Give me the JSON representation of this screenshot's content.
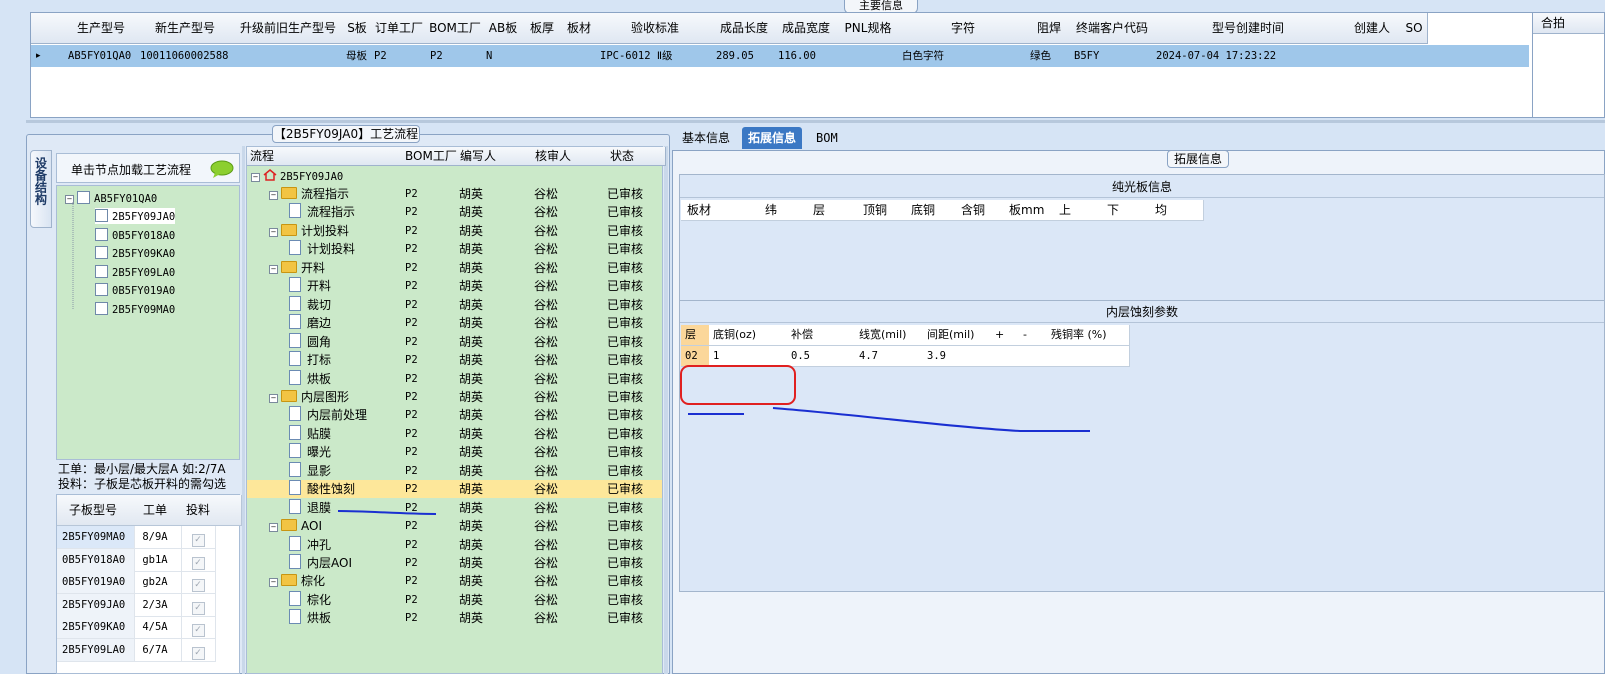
{
  "main_info": {
    "tab_label": "主要信息",
    "columns": [
      "生产型号",
      "新生产型号",
      "升级前旧生产型号",
      "S板",
      "订单工厂",
      "BOM工厂",
      "AB板",
      "板厚",
      "板材",
      "验收标准",
      "成品长度",
      "成品宽度",
      "PNL规格",
      "字符",
      "阻焊",
      "终端客户代码",
      "型号创建时间",
      "创建人",
      "SO"
    ],
    "row": {
      "marker": "▸",
      "生产型号": "AB5FY01QA0",
      "新生产型号": "10011060002588",
      "升级前旧生产型号": "",
      "S板": "母板",
      "订单工厂": "P2",
      "BOM工厂": "P2",
      "AB板": "N",
      "板厚": "",
      "板材": "",
      "验收标准": "IPC-6012 Ⅱ级",
      "成品长度": "289.05",
      "成品宽度": "116.00",
      "PNL规格": "",
      "字符": "白色字符",
      "阻焊": "绿色",
      "终端客户代码": "B5FY",
      "型号创建时间": "2024-07-04 17:23:22",
      "创建人": "",
      "SO": ""
    },
    "right_mini_header": "合",
    "right_mini_header_tail": "拍"
  },
  "process": {
    "title": "【2B5FY09JA0】工艺流程",
    "vertical_tab": "设备结构",
    "load_hint": "单击节点加载工艺流程",
    "tree": {
      "root": "AB5FY01QA0",
      "children": [
        "2B5FY09JA0",
        "0B5FY018A0",
        "2B5FY09KA0",
        "2B5FY09LA0",
        "0B5FY019A0",
        "2B5FY09MA0"
      ]
    },
    "note_line1": "工单：最小层/最大层A 如:2/7A",
    "note_line2": "投料：子板是芯板开料的需勾选",
    "sub_columns": [
      "子板型号",
      "工单",
      "投料"
    ],
    "sub_rows": [
      {
        "model": "2B5FY09MA0",
        "order": "8/9A",
        "checked": "✓"
      },
      {
        "model": "0B5FY018A0",
        "order": "gb1A",
        "checked": "✓"
      },
      {
        "model": "0B5FY019A0",
        "order": "gb2A",
        "checked": "✓"
      },
      {
        "model": "2B5FY09JA0",
        "order": "2/3A",
        "checked": "✓"
      },
      {
        "model": "2B5FY09KA0",
        "order": "4/5A",
        "checked": "✓"
      },
      {
        "model": "2B5FY09LA0",
        "order": "6/7A",
        "checked": "✓"
      }
    ],
    "flow_columns": [
      "流程",
      "BOM工厂",
      "编写人",
      "核审人",
      "状态"
    ],
    "flow_root": "2B5FY09JA0",
    "flow_rows": [
      {
        "name": "流程指示",
        "type": "folder",
        "bom": "P2",
        "writer": "胡英",
        "reviewer": "谷松",
        "status": "已审核"
      },
      {
        "name": "流程指示",
        "type": "doc",
        "bom": "P2",
        "writer": "胡英",
        "reviewer": "谷松",
        "status": "已审核"
      },
      {
        "name": "计划投料",
        "type": "folder",
        "bom": "P2",
        "writer": "胡英",
        "reviewer": "谷松",
        "status": "已审核"
      },
      {
        "name": "计划投料",
        "type": "doc",
        "bom": "P2",
        "writer": "胡英",
        "reviewer": "谷松",
        "status": "已审核"
      },
      {
        "name": "开料",
        "type": "folder",
        "bom": "P2",
        "writer": "胡英",
        "reviewer": "谷松",
        "status": "已审核"
      },
      {
        "name": "开料",
        "type": "doc",
        "bom": "P2",
        "writer": "胡英",
        "reviewer": "谷松",
        "status": "已审核"
      },
      {
        "name": "裁切",
        "type": "doc",
        "bom": "P2",
        "writer": "胡英",
        "reviewer": "谷松",
        "status": "已审核"
      },
      {
        "name": "磨边",
        "type": "doc",
        "bom": "P2",
        "writer": "胡英",
        "reviewer": "谷松",
        "status": "已审核"
      },
      {
        "name": "圆角",
        "type": "doc",
        "bom": "P2",
        "writer": "胡英",
        "reviewer": "谷松",
        "status": "已审核"
      },
      {
        "name": "打标",
        "type": "doc",
        "bom": "P2",
        "writer": "胡英",
        "reviewer": "谷松",
        "status": "已审核"
      },
      {
        "name": "烘板",
        "type": "doc",
        "bom": "P2",
        "writer": "胡英",
        "reviewer": "谷松",
        "status": "已审核"
      },
      {
        "name": "内层图形",
        "type": "folder",
        "bom": "P2",
        "writer": "胡英",
        "reviewer": "谷松",
        "status": "已审核"
      },
      {
        "name": "内层前处理",
        "type": "doc",
        "bom": "P2",
        "writer": "胡英",
        "reviewer": "谷松",
        "status": "已审核"
      },
      {
        "name": "贴膜",
        "type": "doc",
        "bom": "P2",
        "writer": "胡英",
        "reviewer": "谷松",
        "status": "已审核"
      },
      {
        "name": "曝光",
        "type": "doc",
        "bom": "P2",
        "writer": "胡英",
        "reviewer": "谷松",
        "status": "已审核"
      },
      {
        "name": "显影",
        "type": "doc",
        "bom": "P2",
        "writer": "胡英",
        "reviewer": "谷松",
        "status": "已审核"
      },
      {
        "name": "酸性蚀刻",
        "type": "doc",
        "bom": "P2",
        "writer": "胡英",
        "reviewer": "谷松",
        "status": "已审核",
        "selected": true
      },
      {
        "name": "退膜",
        "type": "doc",
        "bom": "P2",
        "writer": "胡英",
        "reviewer": "谷松",
        "status": "已审核"
      },
      {
        "name": "AOI",
        "type": "folder",
        "bom": "P2",
        "writer": "胡英",
        "reviewer": "谷松",
        "status": "已审核"
      },
      {
        "name": "冲孔",
        "type": "doc",
        "bom": "P2",
        "writer": "胡英",
        "reviewer": "谷松",
        "status": "已审核"
      },
      {
        "name": "内层AOI",
        "type": "doc",
        "bom": "P2",
        "writer": "胡英",
        "reviewer": "谷松",
        "status": "已审核"
      },
      {
        "name": "棕化",
        "type": "folder",
        "bom": "P2",
        "writer": "胡英",
        "reviewer": "谷松",
        "status": "已审核"
      },
      {
        "name": "棕化",
        "type": "doc",
        "bom": "P2",
        "writer": "胡英",
        "reviewer": "谷松",
        "status": "已审核"
      },
      {
        "name": "烘板",
        "type": "doc",
        "bom": "P2",
        "writer": "胡英",
        "reviewer": "谷松",
        "status": "已审核"
      }
    ]
  },
  "detail": {
    "tabs": [
      "基本信息",
      "拓展信息",
      "BOM"
    ],
    "active_tab": "拓展信息",
    "panel_label": "拓展信息",
    "bare_board_title": "纯光板信息",
    "bare_board_columns": [
      "板材",
      "纬",
      "层",
      "顶铜",
      "底铜",
      "含铜",
      "板mm",
      "上",
      "下",
      "均"
    ],
    "etch_title": "内层蚀刻参数",
    "etch_columns": [
      "层",
      "底铜(oz)",
      "补偿",
      "线宽(mil)",
      "间距(mil)",
      "+",
      "-",
      "残铜率 (%)"
    ],
    "etch_row": [
      "02",
      "1",
      "0.5",
      "4.7",
      "3.9",
      "",
      "",
      ""
    ]
  },
  "colors": {
    "selected_row": "#9fc7ea",
    "tree_bg": "#cbe9c9",
    "highlight": "#fde79a",
    "active_tab": "#3b78c4",
    "annotation_red": "#e02020",
    "annotation_blue": "#1a2fd1"
  }
}
